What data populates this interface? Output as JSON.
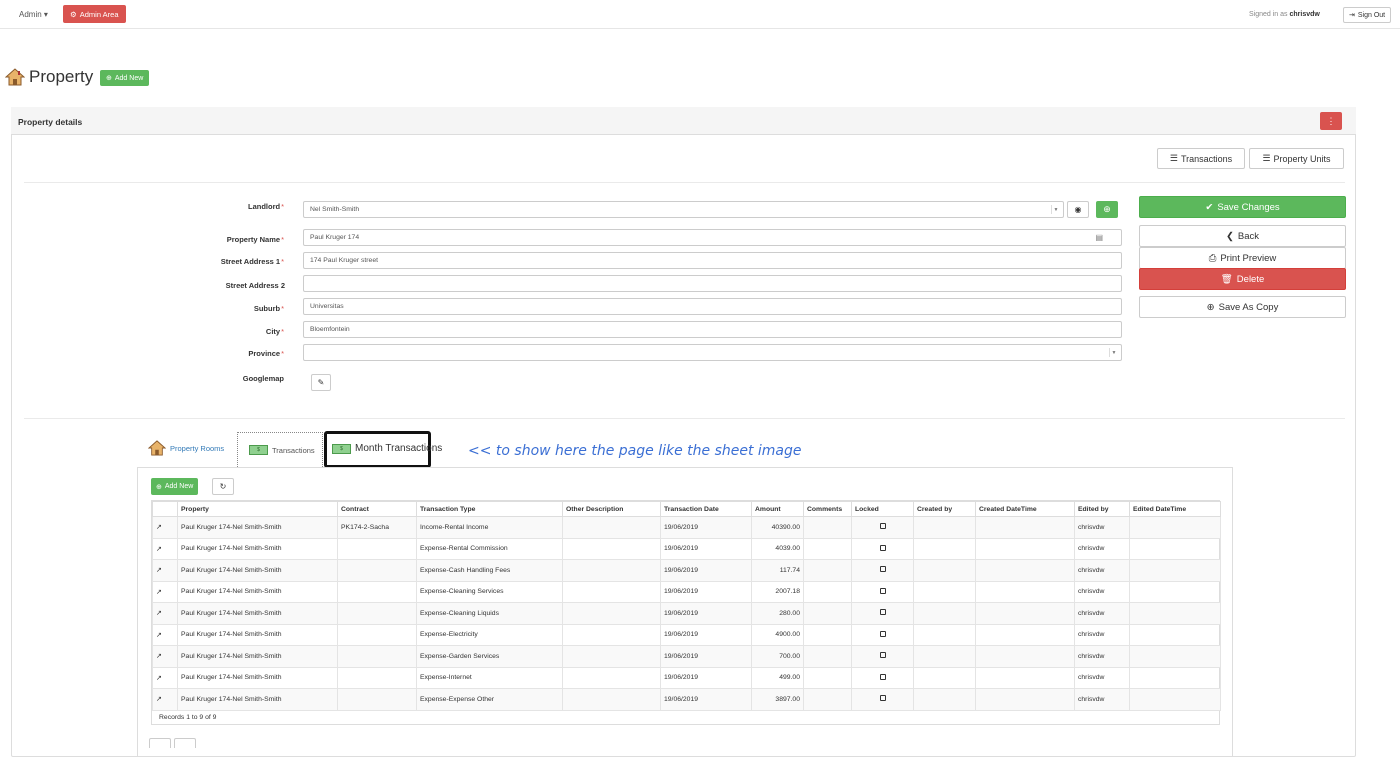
{
  "topbar": {
    "admin_menu": "Admin ▾",
    "admin_area": "Admin Area",
    "signed_in_prefix": "Signed in as ",
    "username": "chrisvdw",
    "sign_out": "Sign Out"
  },
  "page": {
    "title": "Property",
    "add_new": "Add New"
  },
  "panel": {
    "title": "Property details",
    "transactions_btn": "Transactions",
    "property_units_btn": "Property Units"
  },
  "form": {
    "landlord": {
      "label": "Landlord",
      "value": "Nel Smith-Smith"
    },
    "property_name": {
      "label": "Property Name",
      "value": "Paul Kruger 174"
    },
    "street1": {
      "label": "Street Address 1",
      "value": "174 Paul Kruger street"
    },
    "street2": {
      "label": "Street Address 2",
      "value": ""
    },
    "suburb": {
      "label": "Suburb",
      "value": "Universitas"
    },
    "city": {
      "label": "City",
      "value": "Bloemfontein"
    },
    "province": {
      "label": "Province",
      "value": ""
    },
    "googlemap": {
      "label": "Googlemap"
    }
  },
  "actions": {
    "save": "Save Changes",
    "back": "Back",
    "print": "Print Preview",
    "delete": "Delete",
    "save_copy": "Save As Copy"
  },
  "tabs": {
    "rooms": "Property Rooms",
    "transactions": "Transactions",
    "month": "Month Transactions",
    "annotation": "<< to show here the page like the sheet image"
  },
  "grid": {
    "add_new": "Add New",
    "columns": [
      "Property",
      "Contract",
      "Transaction Type",
      "Other Description",
      "Transaction Date",
      "Amount",
      "Comments",
      "Locked",
      "Created by",
      "Created DateTime",
      "Edited by",
      "Edited DateTime"
    ],
    "rows": [
      {
        "property": "Paul Kruger 174-Nel Smith-Smith",
        "contract": "PK174-2-Sacha",
        "type": "Income-Rental Income",
        "date": "19/06/2019",
        "amount": "40390.00",
        "edited_by": "chrisvdw"
      },
      {
        "property": "Paul Kruger 174-Nel Smith-Smith",
        "contract": "",
        "type": "Expense-Rental Commission",
        "date": "19/06/2019",
        "amount": "4039.00",
        "edited_by": "chrisvdw"
      },
      {
        "property": "Paul Kruger 174-Nel Smith-Smith",
        "contract": "",
        "type": "Expense-Cash Handling Fees",
        "date": "19/06/2019",
        "amount": "117.74",
        "edited_by": "chrisvdw"
      },
      {
        "property": "Paul Kruger 174-Nel Smith-Smith",
        "contract": "",
        "type": "Expense-Cleaning Services",
        "date": "19/06/2019",
        "amount": "2007.18",
        "edited_by": "chrisvdw"
      },
      {
        "property": "Paul Kruger 174-Nel Smith-Smith",
        "contract": "",
        "type": "Expense-Cleaning Liquids",
        "date": "19/06/2019",
        "amount": "280.00",
        "edited_by": "chrisvdw"
      },
      {
        "property": "Paul Kruger 174-Nel Smith-Smith",
        "contract": "",
        "type": "Expense-Electricity",
        "date": "19/06/2019",
        "amount": "4900.00",
        "edited_by": "chrisvdw"
      },
      {
        "property": "Paul Kruger 174-Nel Smith-Smith",
        "contract": "",
        "type": "Expense-Garden Services",
        "date": "19/06/2019",
        "amount": "700.00",
        "edited_by": "chrisvdw"
      },
      {
        "property": "Paul Kruger 174-Nel Smith-Smith",
        "contract": "",
        "type": "Expense-Internet",
        "date": "19/06/2019",
        "amount": "499.00",
        "edited_by": "chrisvdw"
      },
      {
        "property": "Paul Kruger 174-Nel Smith-Smith",
        "contract": "",
        "type": "Expense-Expense Other",
        "date": "19/06/2019",
        "amount": "3897.00",
        "edited_by": "chrisvdw"
      }
    ],
    "records": "Records 1 to 9 of 9"
  },
  "icons": {
    "gear": "gear-icon",
    "signout": "sign-out-icon",
    "home": "house-icon",
    "plus": "plus-circle-icon",
    "menu": "vertical-dots-icon",
    "eye": "eye-icon",
    "pencil": "pencil-icon",
    "check": "check-icon",
    "back": "chevron-left-icon",
    "print": "printer-icon",
    "trash": "trash-icon",
    "refresh": "refresh-icon",
    "external": "external-link-icon",
    "cash": "cash-icon"
  },
  "colors": {
    "danger": "#d9534f",
    "success": "#5cb85c",
    "link": "#337ab7",
    "annotation": "#3b6fd4"
  }
}
